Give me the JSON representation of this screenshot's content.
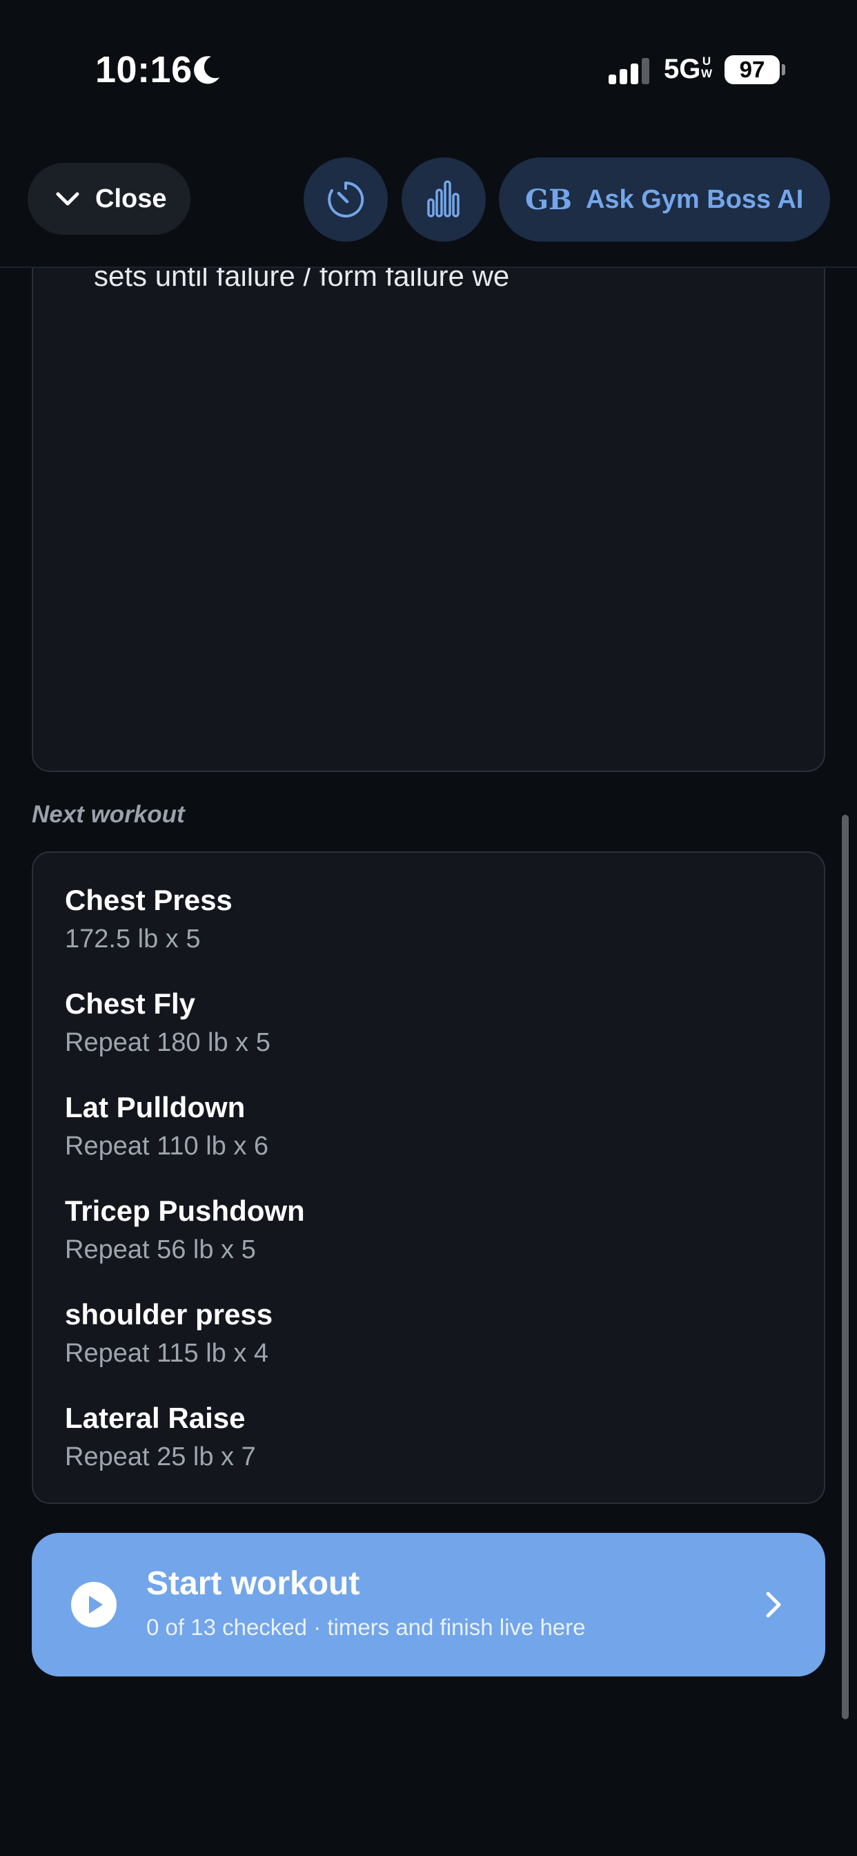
{
  "status_bar": {
    "time": "10:16",
    "network": "5G",
    "network_badge_top": "U",
    "network_badge_bottom": "W",
    "battery": "97"
  },
  "toolbar": {
    "close_label": "Close",
    "ask_logo": "GB",
    "ask_label": "Ask Gym Boss AI"
  },
  "notes": {
    "text": "sets until failure / form failure we"
  },
  "next_workout": {
    "label": "Next workout",
    "exercises": [
      {
        "name": "Chest Press",
        "detail": "172.5 lb x 5"
      },
      {
        "name": "Chest Fly",
        "detail": "Repeat 180 lb x 5"
      },
      {
        "name": "Lat Pulldown",
        "detail": "Repeat 110 lb x 6"
      },
      {
        "name": "Tricep Pushdown",
        "detail": "Repeat 56 lb x 5"
      },
      {
        "name": "shoulder press",
        "detail": "Repeat 115 lb x 4"
      },
      {
        "name": "Lateral Raise",
        "detail": "Repeat 25 lb x 7"
      }
    ]
  },
  "start": {
    "title": "Start workout",
    "subtitle": "0 of 13 checked · timers and finish live here"
  },
  "colors": {
    "accent": "#72a5e9",
    "icon_button_bg": "#1c2d45",
    "background": "#0a0d12"
  }
}
